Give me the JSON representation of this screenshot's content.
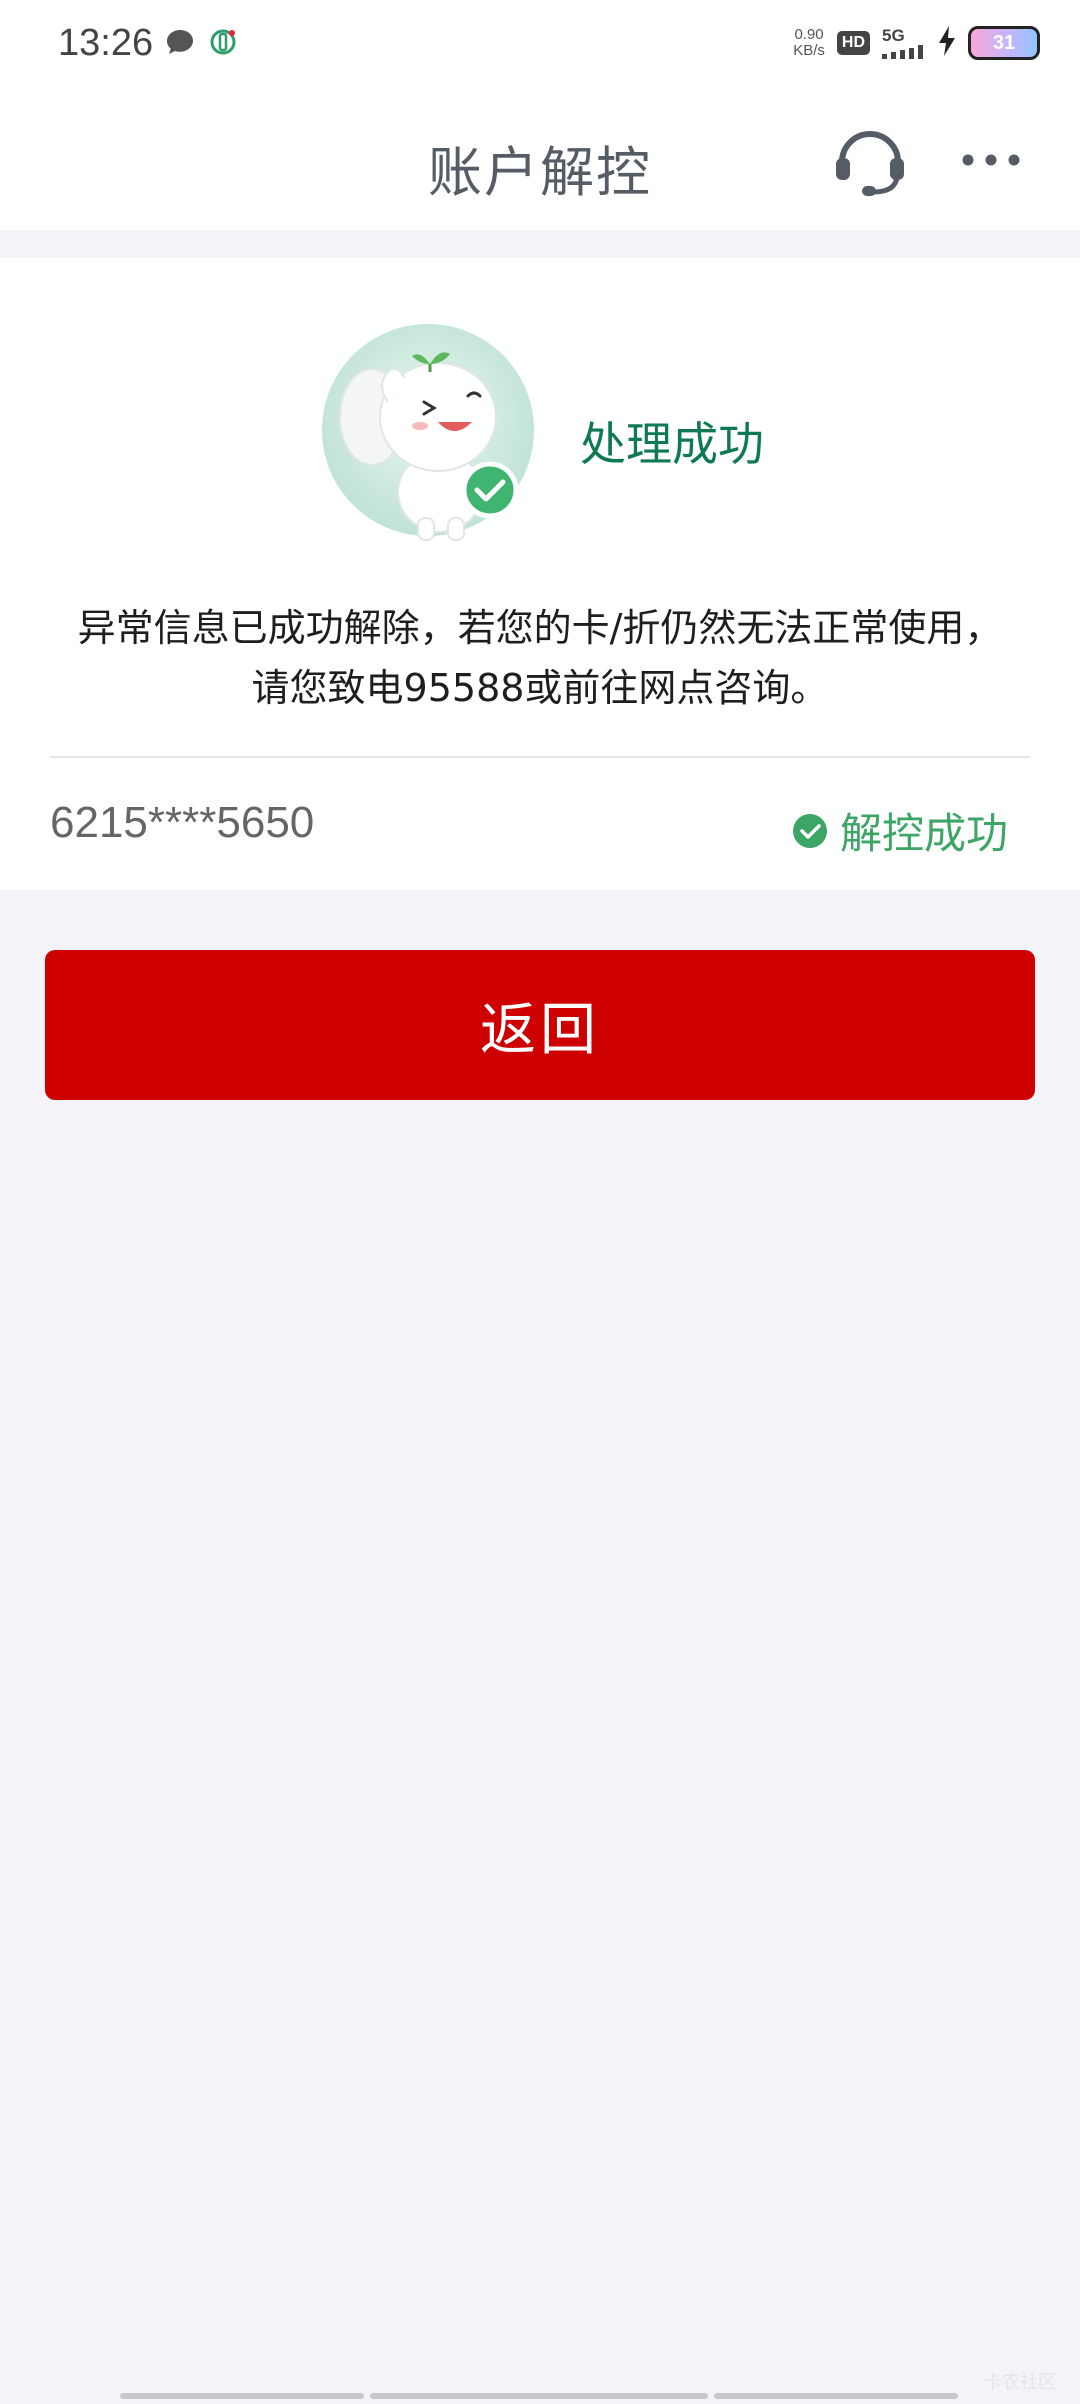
{
  "status_bar": {
    "time": "13:26",
    "net_speed_value": "0.90",
    "net_speed_unit": "KB/s",
    "hd_label": "HD",
    "network_label": "5G",
    "battery_level": "31",
    "icons": [
      "message-bubble-icon",
      "bank-app-icon",
      "signal-bars-icon",
      "charging-bolt-icon",
      "battery-icon"
    ]
  },
  "header": {
    "title": "账户解控",
    "support_icon": "headset-icon",
    "more_icon": "more-dots-icon"
  },
  "result": {
    "status_title": "处理成功",
    "message": "异常信息已成功解除，若您的卡/折仍然无法正常使用，请您致电95588或前往网点咨询。",
    "card_number": "6215****5650",
    "card_status": "解控成功",
    "colors": {
      "success_green": "#3da565",
      "title_green": "#0f7a52"
    }
  },
  "actions": {
    "back_label": "返回",
    "back_color": "#cf0000"
  },
  "watermark": "卡农社区"
}
